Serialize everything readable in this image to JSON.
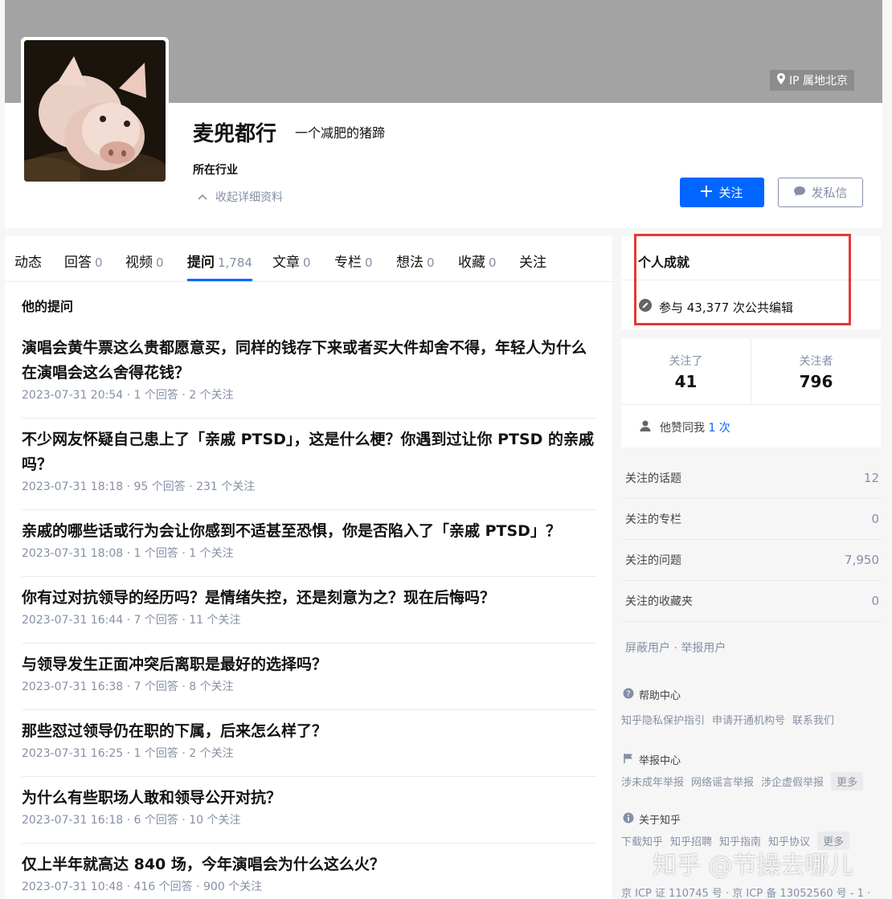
{
  "profile": {
    "ip_location": "IP 属地北京",
    "name": "麦兜都行",
    "headline": "一个减肥的猪蹄",
    "industry_label": "所在行业",
    "collapse_label": "收起详细资料",
    "follow_label": "关注",
    "message_label": "发私信"
  },
  "tabs": [
    {
      "label": "动态",
      "count": ""
    },
    {
      "label": "回答",
      "count": "0"
    },
    {
      "label": "视频",
      "count": "0"
    },
    {
      "label": "提问",
      "count": "1,784"
    },
    {
      "label": "文章",
      "count": "0"
    },
    {
      "label": "专栏",
      "count": "0"
    },
    {
      "label": "想法",
      "count": "0"
    },
    {
      "label": "收藏",
      "count": "0"
    },
    {
      "label": "关注",
      "count": ""
    }
  ],
  "active_tab": "提问",
  "questions_section_title": "他的提问",
  "questions": [
    {
      "title": "演唱会黄牛票这么贵都愿意买，同样的钱存下来或者买大件却舍不得，年轻人为什么在演唱会这么舍得花钱？",
      "meta": "2023-07-31 20:54 · 1 个回答 · 2 个关注"
    },
    {
      "title": "不少网友怀疑自己患上了「亲戚 PTSD」，这是什么梗？你遇到过让你 PTSD 的亲戚吗？",
      "meta": "2023-07-31 18:18 · 95 个回答 · 231 个关注"
    },
    {
      "title": "亲戚的哪些话或行为会让你感到不适甚至恐惧，你是否陷入了「亲戚 PTSD」？",
      "meta": "2023-07-31 18:08 · 1 个回答 · 1 个关注"
    },
    {
      "title": "你有过对抗领导的经历吗？是情绪失控，还是刻意为之？现在后悔吗？",
      "meta": "2023-07-31 16:44 · 7 个回答 · 11 个关注"
    },
    {
      "title": "与领导发生正面冲突后离职是最好的选择吗？",
      "meta": "2023-07-31 16:38 · 7 个回答 · 8 个关注"
    },
    {
      "title": "那些怼过领导仍在职的下属，后来怎么样了？",
      "meta": "2023-07-31 16:25 · 1 个回答 · 2 个关注"
    },
    {
      "title": "为什么有些职场人敢和领导公开对抗？",
      "meta": "2023-07-31 16:18 · 6 个回答 · 10 个关注"
    },
    {
      "title": "仅上半年就高达 840 场，今年演唱会为什么这么火？",
      "meta": "2023-07-31 10:48 · 416 个回答 · 900 个关注"
    }
  ],
  "achievements": {
    "title": "个人成就",
    "edit_text": "参与 43,377 次公共编辑"
  },
  "follow_stats": {
    "following_label": "关注了",
    "following_count": "41",
    "followers_label": "关注者",
    "followers_count": "796",
    "praise_prefix": "他赞同我",
    "praise_count": "1 次"
  },
  "follow_lists": [
    {
      "label": "关注的话题",
      "value": "12"
    },
    {
      "label": "关注的专栏",
      "value": "0"
    },
    {
      "label": "关注的问题",
      "value": "7,950"
    },
    {
      "label": "关注的收藏夹",
      "value": "0"
    }
  ],
  "block_report": "屏蔽用户 · 举报用户",
  "footer": {
    "help_title": "帮助中心",
    "help_links": [
      "知乎隐私保护指引",
      "申请开通机构号",
      "联系我们"
    ],
    "report_title": "举报中心",
    "report_links": [
      "涉未成年举报",
      "网络谣言举报",
      "涉企虚假举报"
    ],
    "about_title": "关于知乎",
    "about_links": [
      "下载知乎",
      "知乎招聘",
      "知乎指南",
      "知乎协议"
    ],
    "more_label": "更多",
    "copyright": "京 ICP 证 110745 号 · 京 ICP 备 13052560 号 - 1 ·"
  },
  "watermark": "知乎 @节操去哪儿",
  "colors": {
    "accent": "#0066ff",
    "highlight_box": "#e53935",
    "cover": "#a3a3a3"
  }
}
